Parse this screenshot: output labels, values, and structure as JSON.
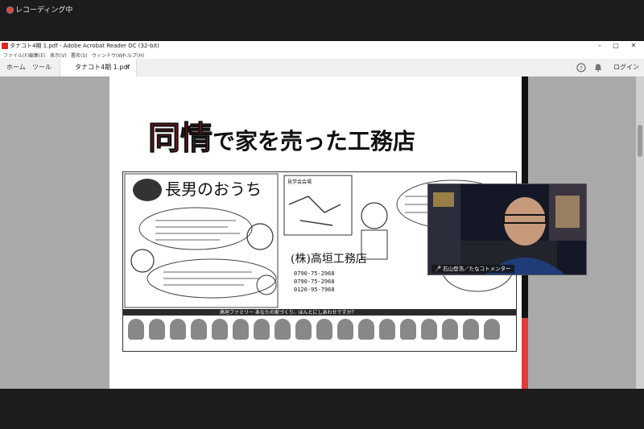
{
  "recording": {
    "status": "レコーディング中"
  },
  "window": {
    "title": "タナコト4期 1.pdf - Adobe Acrobat Reader DC (32-bit)",
    "controls": {
      "minimize": "–",
      "maximize": "□",
      "close": "✕"
    }
  },
  "menu": {
    "items": [
      "ファイル(F)",
      "編集(E)",
      "表示(V)",
      "署名(S)",
      "ウィンドウ(W)",
      "ヘルプ(H)"
    ]
  },
  "tabs": {
    "home": "ホーム",
    "tools": "ツール",
    "document": "タナコト4期 1.pdf",
    "close": "✕",
    "login": "ログイン",
    "help_icon": "question-circle-icon",
    "bell_icon": "bell-icon"
  },
  "document": {
    "headline_red": "同情",
    "headline_black": "で家を売った工務店",
    "flyer": {
      "title": "長男のおうち",
      "company": "(株)高垣工務店",
      "phones": [
        "0790-75-2968",
        "0790-75-2968",
        "0120-95-7968"
      ],
      "strip": "高垣ファミリー あなたの家づくり、ほんとにしあわせですか？",
      "map_label": "見学会会場"
    }
  },
  "webcam": {
    "name_label": "石山登浩／たなコトメンター"
  },
  "colors": {
    "headline_red": "#e12020",
    "recording_dot": "#e0443a",
    "page_bar_red": "#e03b3b"
  }
}
